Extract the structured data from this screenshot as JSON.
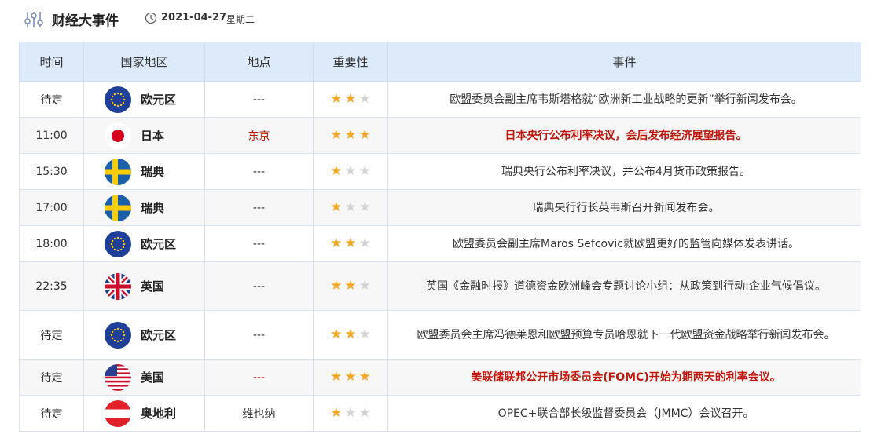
{
  "header": {
    "title": "财经大事件",
    "date": "2021-04-27",
    "weekday": "星期二"
  },
  "columns": {
    "time": "时间",
    "country": "国家地区",
    "location": "地点",
    "importance": "重要性",
    "event": "事件"
  },
  "colors": {
    "highlight": "#c0150b",
    "star_on": "#f5a623",
    "star_off": "#d3d3d3",
    "header_bg": "#ddeaf9"
  },
  "rows": [
    {
      "time": "待定",
      "flag": "eu-flag",
      "country": "欧元区",
      "location": "---",
      "stars": 2,
      "event": "欧盟委员会副主席韦斯塔格就“欧洲新工业战略的更新”举行新闻发布会。",
      "highlight": false
    },
    {
      "time": "11:00",
      "flag": "jp-flag",
      "country": "日本",
      "location": "东京",
      "stars": 3,
      "event": "日本央行公布利率决议，会后发布经济展望报告。",
      "highlight": true
    },
    {
      "time": "15:30",
      "flag": "se-flag",
      "country": "瑞典",
      "location": "---",
      "stars": 1,
      "event": "瑞典央行公布利率决议，并公布4月货币政策报告。",
      "highlight": false
    },
    {
      "time": "17:00",
      "flag": "se-flag",
      "country": "瑞典",
      "location": "---",
      "stars": 1,
      "event": "瑞典央行行长英韦斯召开新闻发布会。",
      "highlight": false
    },
    {
      "time": "18:00",
      "flag": "eu-flag",
      "country": "欧元区",
      "location": "---",
      "stars": 2,
      "event": "欧盟委员会副主席Maros Sefcovic就欧盟更好的监管向媒体发表讲话。",
      "highlight": false
    },
    {
      "time": "22:35",
      "flag": "uk-flag",
      "country": "英国",
      "location": "---",
      "stars": 2,
      "event": "英国《金融时报》道德资金欧洲峰会专题讨论小组：从政策到行动:企业气候倡议。",
      "highlight": false
    },
    {
      "time": "待定",
      "flag": "eu-flag",
      "country": "欧元区",
      "location": "---",
      "stars": 2,
      "event": "欧盟委员会主席冯德莱恩和欧盟预算专员哈恩就下一代欧盟资金战略举行新闻发布会。",
      "highlight": false
    },
    {
      "time": "待定",
      "flag": "us-flag",
      "country": "美国",
      "location": "---",
      "stars": 3,
      "event": "美联储联邦公开市场委员会(FOMC)开始为期两天的利率会议。",
      "highlight": true
    },
    {
      "time": "待定",
      "flag": "at-flag",
      "country": "奥地利",
      "location": "维也纳",
      "stars": 1,
      "event": "OPEC+联合部长级监督委员会（JMMC）会议召开。",
      "highlight": false
    }
  ]
}
